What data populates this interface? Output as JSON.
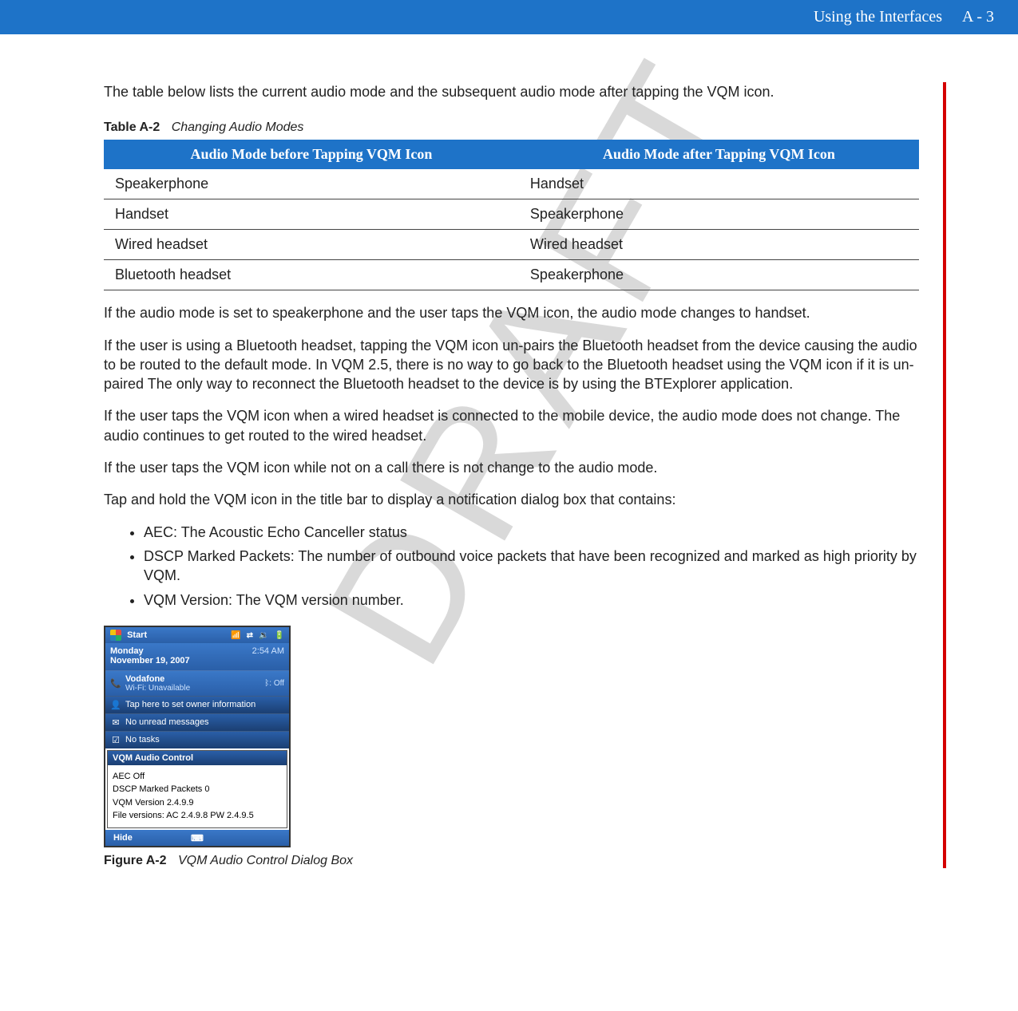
{
  "header": {
    "section": "Using the Interfaces",
    "page_number": "A - 3"
  },
  "watermark": "DRAFT",
  "intro_paragraph": "The table below lists the current audio mode and the subsequent audio mode after tapping the VQM icon.",
  "table_caption": {
    "label": "Table A-2",
    "title": "Changing Audio Modes"
  },
  "table": {
    "header_before": "Audio Mode before Tapping VQM Icon",
    "header_after": "Audio Mode after Tapping VQM Icon",
    "rows": [
      {
        "before": "Speakerphone",
        "after": "Handset"
      },
      {
        "before": "Handset",
        "after": "Speakerphone"
      },
      {
        "before": "Wired headset",
        "after": "Wired headset"
      },
      {
        "before": "Bluetooth headset",
        "after": "Speakerphone"
      }
    ]
  },
  "paragraphs": {
    "p1": "If the audio mode is set to speakerphone and the user taps the VQM icon, the audio mode changes to handset.",
    "p2": "If the user is using a Bluetooth headset, tapping the VQM icon un-pairs the Bluetooth headset from the device causing the audio to be routed to the default mode. In VQM 2.5, there is no way to go back to the Bluetooth headset using the VQM icon if it is un-paired The only way to reconnect the Bluetooth headset to the device is by using the BTExplorer application.",
    "p3": "If the user taps the VQM icon when a wired headset is connected to the mobile device, the audio mode does not change. The audio continues to get routed to the wired headset.",
    "p4": "If the user taps the VQM icon while not on a call there is not change to the audio mode.",
    "p5": "Tap and hold the VQM icon in the title bar to display a notification dialog box that contains:"
  },
  "bullets": {
    "b1": "AEC: The Acoustic Echo Canceller status",
    "b2": "DSCP Marked Packets: The number of outbound voice packets that have been recognized and marked as high priority by VQM.",
    "b3": "VQM Version: The VQM version number."
  },
  "device": {
    "start_label": "Start",
    "date_day": "Monday",
    "date_full": "November 19, 2007",
    "time": "2:54 AM",
    "carrier": "Vodafone",
    "wifi_status": "Wi-Fi: Unavailable",
    "bt_status": ": Off",
    "owner_row": "Tap here to set owner information",
    "messages_row": "No unread messages",
    "tasks_row": "No tasks",
    "dialog_title": "VQM Audio Control",
    "dialog_lines": {
      "l1": "AEC Off",
      "l2": "DSCP Marked Packets 0",
      "l3": "VQM Version 2.4.9.9",
      "l4": "File versions: AC 2.4.9.8 PW 2.4.9.5"
    },
    "softkey_left": "Hide"
  },
  "figure_caption": {
    "label": "Figure A-2",
    "title": "VQM Audio Control Dialog Box"
  }
}
